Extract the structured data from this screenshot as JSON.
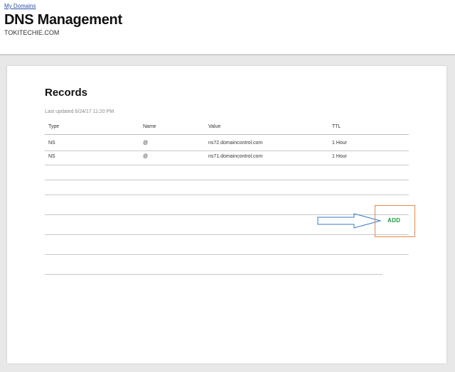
{
  "header": {
    "breadcrumb": "My Domains",
    "title": "DNS Management",
    "domain": "TOKITECHIE.COM"
  },
  "records": {
    "title": "Records",
    "last_updated": "Last updated 6/24/17 11:20 PM",
    "columns": [
      "Type",
      "Name",
      "Value",
      "TTL"
    ],
    "rows": [
      {
        "type": "NS",
        "name": "@",
        "value": "ns72.domaincontrol.com",
        "ttl": "1 Hour"
      },
      {
        "type": "NS",
        "name": "@",
        "value": "ns71.domaincontrol.com",
        "ttl": "1 Hour"
      }
    ],
    "add_label": "ADD"
  },
  "colors": {
    "accent_add": "#1c9a3a",
    "highlight_box": "#e8874c",
    "annotation_arrow": "#3b78c4"
  },
  "icons": [
    "arrow-annotation-icon"
  ]
}
